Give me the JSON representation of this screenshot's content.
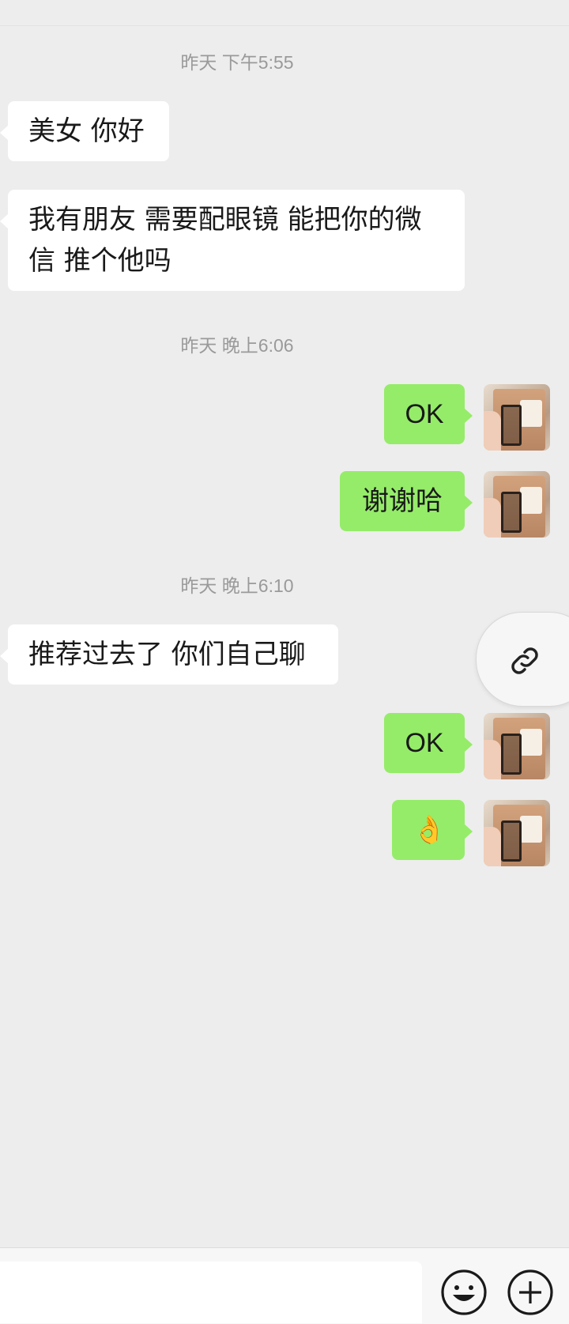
{
  "messages": [
    {
      "type": "time",
      "text": "昨天 下午5:55"
    },
    {
      "type": "received",
      "text": "美女 你好"
    },
    {
      "type": "received",
      "text": "我有朋友 需要配眼镜 能把你的微信 推个他吗"
    },
    {
      "type": "time",
      "text": "昨天 晚上6:06"
    },
    {
      "type": "sent",
      "text": "OK"
    },
    {
      "type": "sent",
      "text": "谢谢哈"
    },
    {
      "type": "time",
      "text": "昨天 晚上6:10"
    },
    {
      "type": "received",
      "text": "推荐过去了 你们自己聊"
    },
    {
      "type": "sent",
      "text": "OK"
    },
    {
      "type": "sent",
      "text": "👌"
    }
  ],
  "icons": {
    "float": "link-icon",
    "emoji": "smiley-icon",
    "more": "plus-circle-icon"
  },
  "colors": {
    "background": "#ededed",
    "sent_bubble": "#95ec69",
    "received_bubble": "#ffffff",
    "timestamp": "#9a9a9a"
  }
}
